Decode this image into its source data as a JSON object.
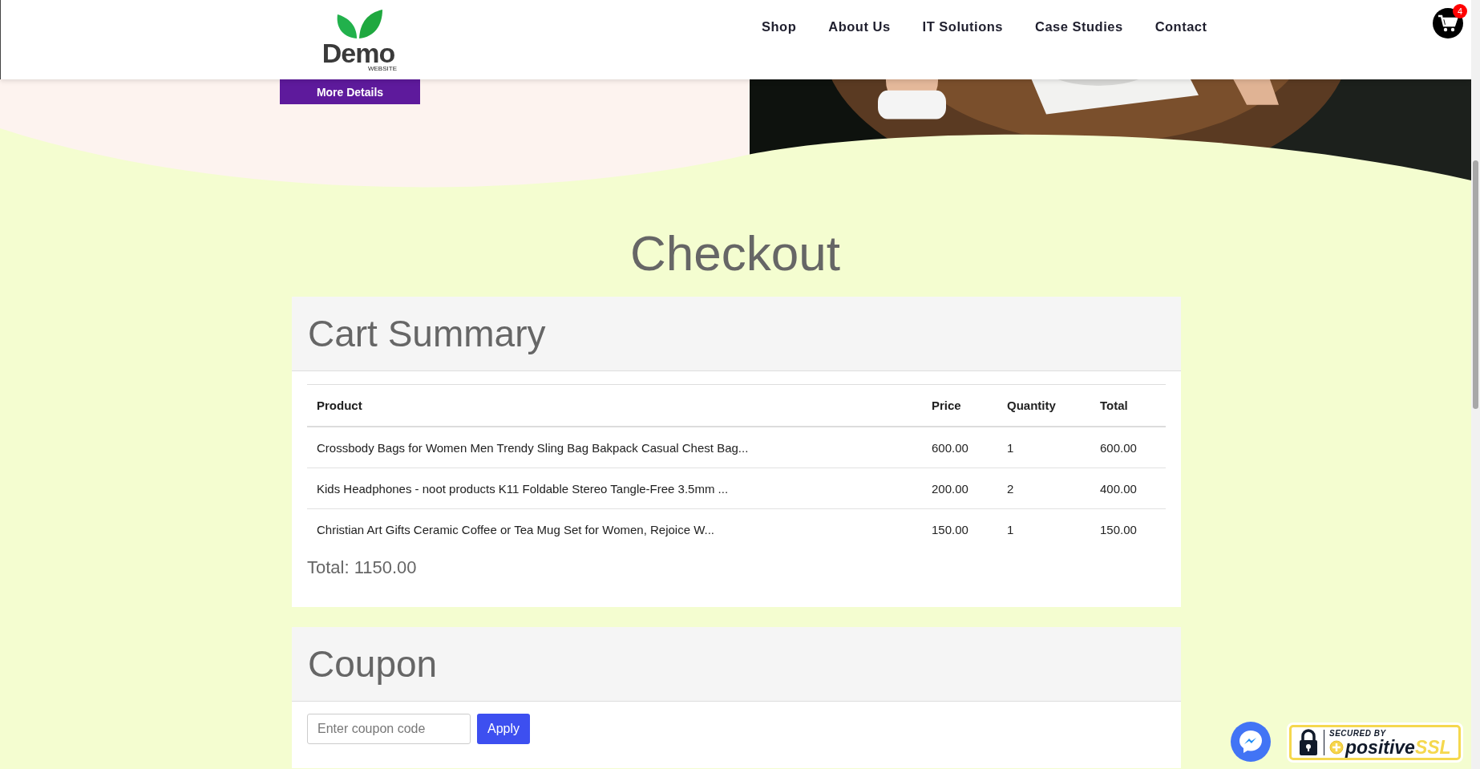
{
  "header": {
    "logo": {
      "name": "Demo",
      "tagline": "WEBSITE"
    },
    "nav": [
      {
        "label": "Shop"
      },
      {
        "label": "About Us"
      },
      {
        "label": "IT Solutions"
      },
      {
        "label": "Case Studies"
      },
      {
        "label": "Contact"
      }
    ],
    "cart_count": "4"
  },
  "hero": {
    "button": "More Details"
  },
  "title": "Checkout",
  "cart_summary": {
    "heading": "Cart Summary",
    "columns": [
      "Product",
      "Price",
      "Quantity",
      "Total"
    ],
    "rows": [
      [
        "Crossbody Bags for Women Men Trendy Sling Bag Bakpack Casual Chest Bag...",
        "600.00",
        "1",
        "600.00"
      ],
      [
        "Kids Headphones - noot products K11 Foldable Stereo Tangle-Free 3.5mm ...",
        "200.00",
        "2",
        "400.00"
      ],
      [
        "Christian Art Gifts Ceramic Coffee or Tea Mug Set for Women, Rejoice W...",
        "150.00",
        "1",
        "150.00"
      ]
    ],
    "total": "Total: 1150.00"
  },
  "coupon": {
    "heading": "Coupon",
    "placeholder": "Enter coupon code",
    "button": "Apply"
  },
  "ssl_badge": {
    "line1": "SECURED BY",
    "brand": "positive",
    "brand_suffix": "SSL"
  }
}
